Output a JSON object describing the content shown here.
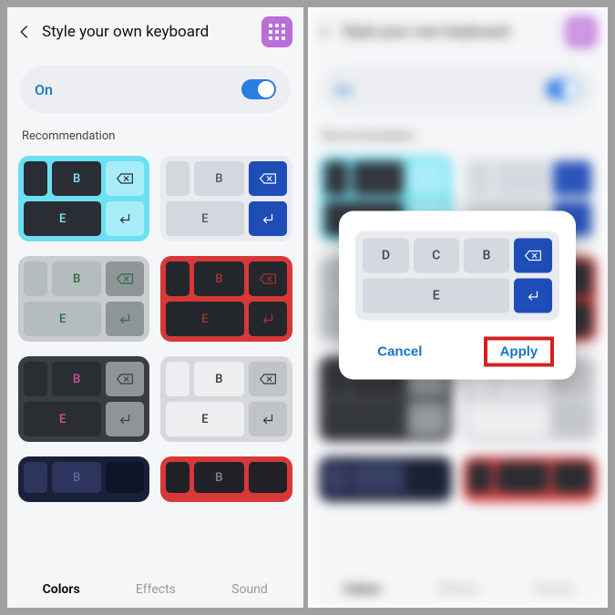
{
  "header": {
    "title": "Style your own keyboard"
  },
  "toggle": {
    "label": "On",
    "state": true
  },
  "section_label": "Recommendation",
  "tabs": {
    "colors": "Colors",
    "effects": "Effects",
    "sound": "Sound"
  },
  "preview_keys": {
    "d": "D",
    "c": "C",
    "b": "B",
    "e": "E"
  },
  "dialog": {
    "cancel": "Cancel",
    "apply": "Apply"
  },
  "colors": {
    "accent_purple": "#bb6dd9",
    "accent_blue": "#1773c7",
    "highlight_red": "#d62020"
  }
}
